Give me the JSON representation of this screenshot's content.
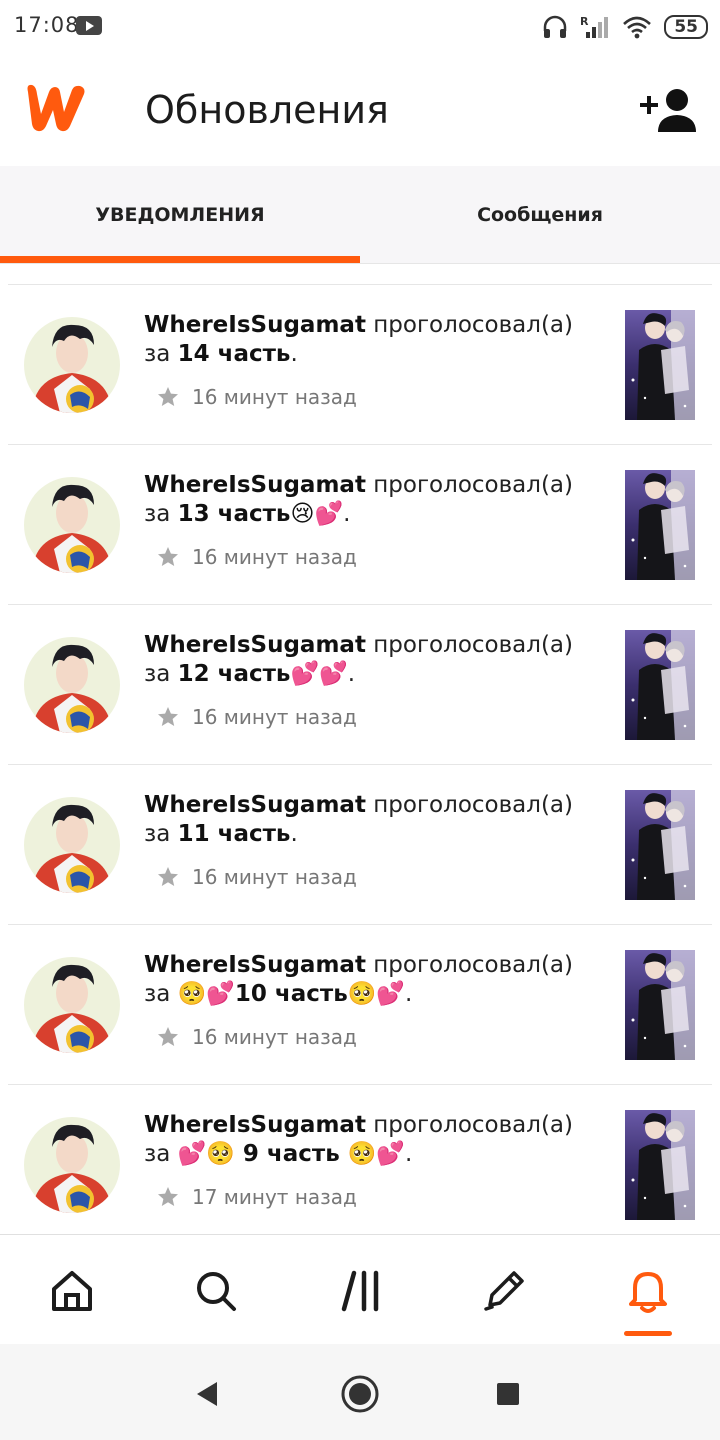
{
  "status_bar": {
    "time": "17:08",
    "battery": "55"
  },
  "header": {
    "title": "Обновления"
  },
  "tabs": [
    {
      "label": "УВЕДОМЛЕНИЯ",
      "active": true
    },
    {
      "label": "Сообщения",
      "active": false
    }
  ],
  "notifications": [
    {
      "user": "WhereIsSugamat",
      "action": " проголосовал(а) за ",
      "part": "14 часть",
      "suffix": ".",
      "time": "16 минут назад"
    },
    {
      "user": "WhereIsSugamat",
      "action": " проголосовал(а) за ",
      "part": "13 часть😢💕",
      "suffix": ".",
      "time": "16 минут назад"
    },
    {
      "user": "WhereIsSugamat",
      "action": " проголосовал(а) за ",
      "part": "12 часть💕💕",
      "suffix": ".",
      "time": "16 минут назад"
    },
    {
      "user": "WhereIsSugamat",
      "action": " проголосовал(а) за ",
      "part": "11 часть",
      "suffix": ".",
      "time": "16 минут назад"
    },
    {
      "user": "WhereIsSugamat",
      "action": " проголосовал(а) за ",
      "part": "🥺💕10 часть🥺💕",
      "suffix": ".",
      "time": "16 минут назад"
    },
    {
      "user": "WhereIsSugamat",
      "action": " проголосовал(а) за ",
      "part": "💕🥺 9 часть 🥺💕",
      "suffix": ".",
      "time": "17 минут назад"
    }
  ],
  "icons": {
    "logo": "wattpad-logo-icon",
    "add_friend": "add-person-icon",
    "vote": "star-icon",
    "nav": [
      "home-icon",
      "search-icon",
      "library-icon",
      "pencil-icon",
      "bell-icon"
    ],
    "system": [
      "back-icon",
      "home-circle-icon",
      "recents-icon"
    ]
  },
  "colors": {
    "accent": "#ff5a0e"
  }
}
